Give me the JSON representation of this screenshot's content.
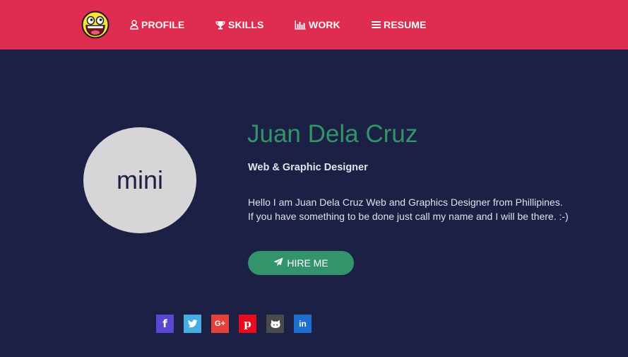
{
  "nav": {
    "logo_icon": "awesome-face-icon",
    "items": [
      {
        "label": "PROFILE",
        "icon": "user-icon"
      },
      {
        "label": "SKILLS",
        "icon": "trophy-icon"
      },
      {
        "label": "WORK",
        "icon": "bar-chart-icon"
      },
      {
        "label": "RESUME",
        "icon": "menu-lines-icon"
      }
    ]
  },
  "profile": {
    "avatar_text": "mini",
    "name": "Juan Dela Cruz",
    "title": "Web & Graphic Designer",
    "bio_line1": "Hello I am Juan Dela Cruz Web and Graphics Designer from Phillipines.",
    "bio_line2": "If you have something to be done just call my name and I will be there. :-)",
    "hire_label": "HIRE ME",
    "hire_icon": "paper-plane-icon"
  },
  "social": [
    {
      "name": "facebook",
      "glyph": "f",
      "color": "#5a47cf"
    },
    {
      "name": "twitter",
      "glyph": "",
      "color": "#45aee0"
    },
    {
      "name": "google-plus",
      "glyph": "G+",
      "color": "#e6403a"
    },
    {
      "name": "pinterest",
      "glyph": "p",
      "color": "#ea0a1e"
    },
    {
      "name": "github",
      "glyph": "",
      "color": "#4a4a4a"
    },
    {
      "name": "linkedin",
      "glyph": "in",
      "color": "#1c6fd1"
    }
  ],
  "colors": {
    "navbar": "#de2d50",
    "background": "#1c2044",
    "accent": "#33936a",
    "avatar": "#d8d5d8"
  }
}
